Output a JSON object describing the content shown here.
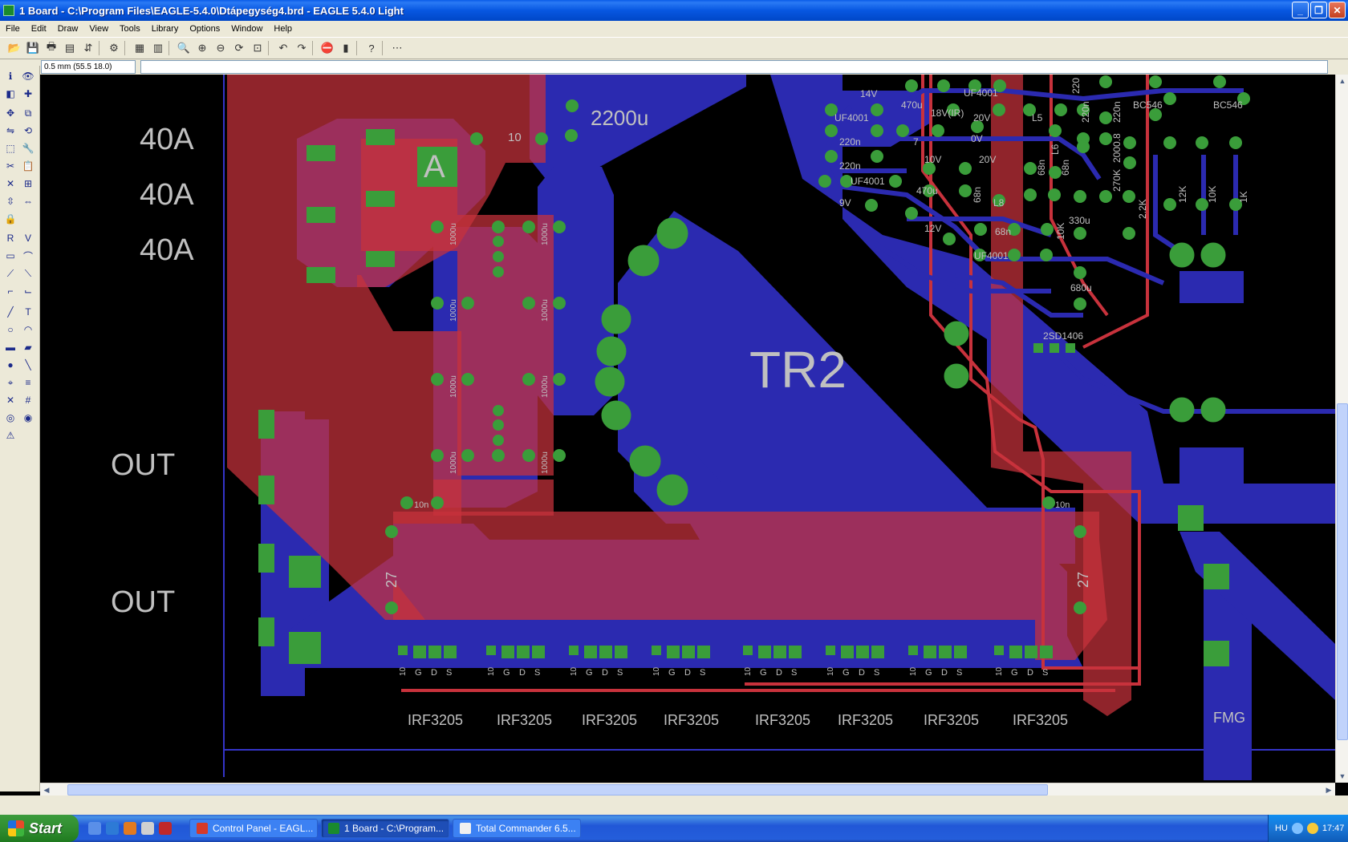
{
  "window": {
    "title": "1 Board - C:\\Program Files\\EAGLE-5.4.0\\Dtápegység4.brd - EAGLE 5.4.0 Light",
    "buttons": {
      "minimize": "_",
      "maximize": "❐",
      "close": "✕"
    }
  },
  "menu": [
    "File",
    "Edit",
    "Draw",
    "View",
    "Tools",
    "Library",
    "Options",
    "Window",
    "Help"
  ],
  "command": {
    "coordinate": "0.5 mm (55.5 18.0)",
    "input_value": ""
  },
  "board": {
    "labels": {
      "amp1": "40A",
      "amp2": "40A",
      "amp3": "40A",
      "out1": "OUT",
      "out2": "OUT",
      "tr2": "TR2",
      "cap": "2200u",
      "a_pad": "A",
      "pad10": "10",
      "r27a": "27",
      "r27b": "27",
      "c10n_a": "10n",
      "c10n_b": "10n",
      "fmg": "FMG"
    },
    "caps_1000u": [
      "1000u",
      "1000u",
      "1000u",
      "1000u",
      "1000u",
      "1000u",
      "1000u",
      "1000u"
    ],
    "mosfets": [
      "IRF3205",
      "IRF3205",
      "IRF3205",
      "IRF3205",
      "IRF3205",
      "IRF3205",
      "IRF3205",
      "IRF3205"
    ],
    "gds": [
      "G",
      "D",
      "S"
    ],
    "gate_r": "10",
    "small_labels": [
      "14V",
      "470u",
      "18V(IR)",
      "UF4001",
      "UF4001",
      "220n",
      "220n",
      "20V",
      "L5",
      "L6",
      "BC546",
      "BC546",
      "220n",
      "7",
      "10V",
      "0V",
      "20V",
      "68n",
      "68n",
      "2000.8",
      "12K",
      "10K",
      "1K",
      "220n",
      "UF4001",
      "470u",
      "68n",
      "L8",
      "270K",
      "9V",
      "12V",
      "68n",
      "10K",
      "330u",
      "2.2K",
      "UF4001",
      "680u",
      "2SD1406",
      "220"
    ]
  },
  "taskbar": {
    "start": "Start",
    "items": [
      "Control Panel - EAGL...",
      "1 Board - C:\\Program...",
      "Total Commander 6.5..."
    ],
    "lang": "HU",
    "clock": "17:47"
  },
  "colors": {
    "top_layer": "#c8323c",
    "bottom_layer": "#2b2ab0",
    "pad": "#3a9d3a",
    "text": "#c0c0c0",
    "outline": "#2b2ab0"
  }
}
